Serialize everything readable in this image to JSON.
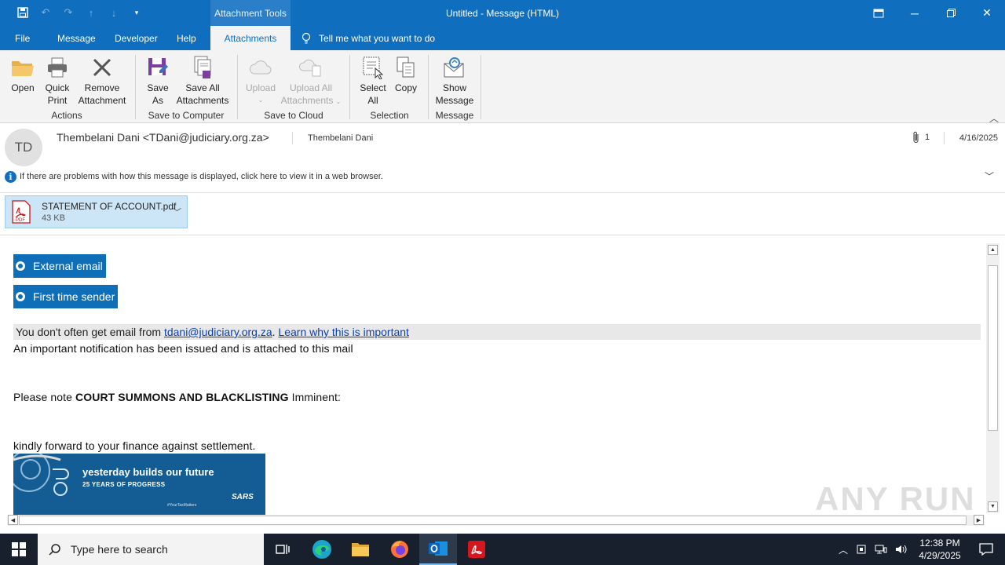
{
  "window": {
    "title": "Untitled  -  Message (HTML)",
    "context_tab_label": "Attachment Tools"
  },
  "ribbon_tabs": [
    "File",
    "Message",
    "Developer",
    "Help",
    "Attachments"
  ],
  "tell_me": "Tell me what you want to do",
  "ribbon": {
    "actions": {
      "open": "Open",
      "quick_print_1": "Quick",
      "quick_print_2": "Print",
      "remove_1": "Remove",
      "remove_2": "Attachment",
      "group": "Actions"
    },
    "save_computer": {
      "save_as_1": "Save",
      "save_as_2": "As",
      "save_all_1": "Save All",
      "save_all_2": "Attachments",
      "group": "Save to Computer"
    },
    "save_cloud": {
      "upload": "Upload",
      "upload_all_1": "Upload All",
      "upload_all_2": "Attachments",
      "group": "Save to Cloud"
    },
    "selection": {
      "select_all_1": "Select",
      "select_all_2": "All",
      "copy": "Copy",
      "group": "Selection"
    },
    "message": {
      "show_1": "Show",
      "show_2": "Message",
      "group": "Message"
    }
  },
  "header": {
    "avatar_initials": "TD",
    "sender": "Thembelani Dani <TDani@judiciary.org.za>",
    "to": "Thembelani Dani",
    "attachment_count": "1",
    "date": "4/16/2025",
    "info_text": "If there are problems with how this message is displayed, click here to view it in a web browser."
  },
  "attachment": {
    "name": "STATEMENT OF ACCOUNT.pdf",
    "size": "43 KB"
  },
  "body": {
    "tag_external": "External email",
    "tag_first": "First time sender",
    "notice_prefix": "You don't often get email from ",
    "notice_email": "tdani@judiciary.org.za",
    "notice_sep": ". ",
    "notice_link": "Learn why this is important",
    "line1": "An important notification has been issued and is attached to this mail",
    "line2_prefix": "Please note ",
    "line2_bold": "COURT SUMMONS AND BLACKLISTING",
    "line2_suffix": " Imminent:",
    "line3": "kindly forward to your finance against settlement.",
    "banner_line1": "yesterday builds our future",
    "banner_line2": "25 YEARS OF PROGRESS",
    "banner_tag": "#YourTaxMatters",
    "banner_logo": "SARS"
  },
  "watermark": "ANY RUN",
  "taskbar": {
    "search_placeholder": "Type here to search",
    "time": "12:38 PM",
    "date": "4/29/2025"
  },
  "colors": {
    "titlebar": "#106ebe",
    "tag": "#0e6eb8",
    "attachment_bg": "#cde6f7",
    "taskbar": "#17202c"
  }
}
